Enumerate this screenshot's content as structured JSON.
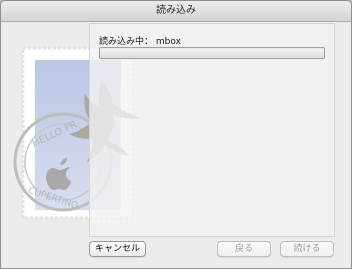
{
  "window": {
    "title": "読み込み"
  },
  "status": {
    "label": "読み込み中：",
    "mailbox": "mbox",
    "progress": 0
  },
  "buttons": {
    "cancel": "キャンセル",
    "back": "戻る",
    "continue": "続ける"
  },
  "stamp": {
    "postmark_text_top": "HELLO FR",
    "postmark_text_bottom": "CUPERTINO",
    "stamp_color": "#c9d2ea",
    "bird_color": "#a9a49c"
  }
}
